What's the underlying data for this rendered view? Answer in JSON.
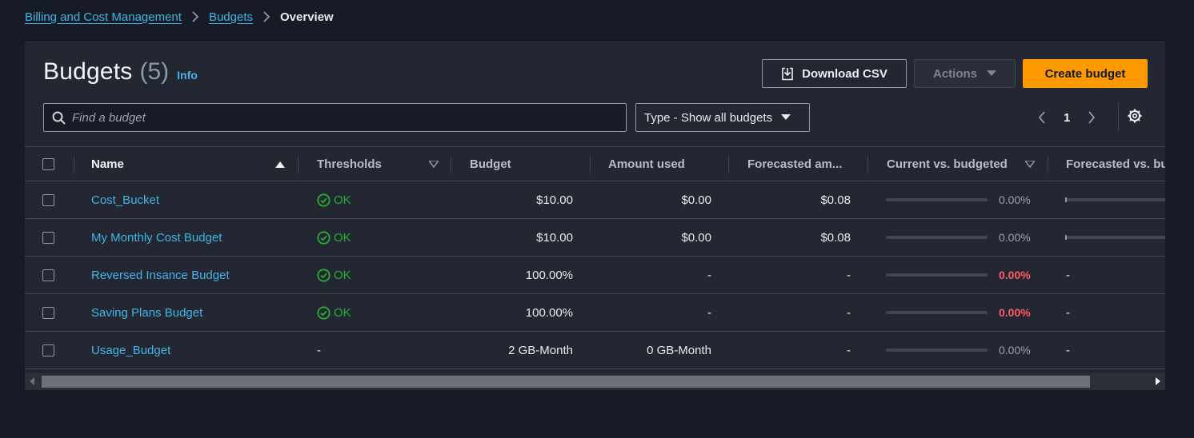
{
  "breadcrumb": {
    "items": [
      "Billing and Cost Management",
      "Budgets"
    ],
    "current": "Overview"
  },
  "header": {
    "title": "Budgets",
    "count": "(5)",
    "info": "Info"
  },
  "toolbar": {
    "download_csv": "Download CSV",
    "actions": "Actions",
    "create_budget": "Create budget"
  },
  "search": {
    "placeholder": "Find a budget"
  },
  "filter": {
    "type_label": "Type - Show all budgets"
  },
  "pagination": {
    "current_page": "1"
  },
  "table": {
    "columns": {
      "name": "Name",
      "thresholds": "Thresholds",
      "budget": "Budget",
      "amount_used": "Amount used",
      "forecasted": "Forecasted am...",
      "current_vs_budgeted": "Current vs. budgeted",
      "forecasted_vs_budgeted": "Forecasted vs. bu"
    },
    "rows": [
      {
        "name": "Cost_Bucket",
        "threshold": "OK",
        "budget": "$10.00",
        "amount_used": "$0.00",
        "forecasted": "$0.08",
        "current_pct": "0.00%",
        "current_pct_alert": false,
        "forecasted_vs": "",
        "current_progress": 0
      },
      {
        "name": "My Monthly Cost Budget",
        "threshold": "OK",
        "budget": "$10.00",
        "amount_used": "$0.00",
        "forecasted": "$0.08",
        "current_pct": "0.00%",
        "current_pct_alert": false,
        "forecasted_vs": "",
        "current_progress": 0
      },
      {
        "name": "Reversed Insance Budget",
        "threshold": "OK",
        "budget": "100.00%",
        "amount_used": "-",
        "forecasted": "-",
        "current_pct": "0.00%",
        "current_pct_alert": true,
        "forecasted_vs": "-",
        "current_progress": 0
      },
      {
        "name": "Saving Plans Budget",
        "threshold": "OK",
        "budget": "100.00%",
        "amount_used": "-",
        "forecasted": "-",
        "current_pct": "0.00%",
        "current_pct_alert": true,
        "forecasted_vs": "-",
        "current_progress": 0
      },
      {
        "name": "Usage_Budget",
        "threshold": "-",
        "budget": "2 GB-Month",
        "amount_used": "0 GB-Month",
        "forecasted": "-",
        "current_pct": "0.00%",
        "current_pct_alert": false,
        "forecasted_vs": "-",
        "current_progress": 0
      }
    ]
  },
  "colors": {
    "background": "#161b25",
    "panel": "#232732",
    "link": "#42b4e6",
    "primary_button": "#ff9900",
    "ok_status": "#29ad32",
    "alert_text": "#ff5d64"
  },
  "icons": [
    "chevron-right-icon",
    "download-icon",
    "caret-down-icon",
    "search-icon",
    "chevron-left-icon",
    "gear-icon",
    "check-circle-icon",
    "sort-ascending-icon",
    "sort-icon",
    "scroll-left-icon",
    "scroll-right-icon"
  ]
}
